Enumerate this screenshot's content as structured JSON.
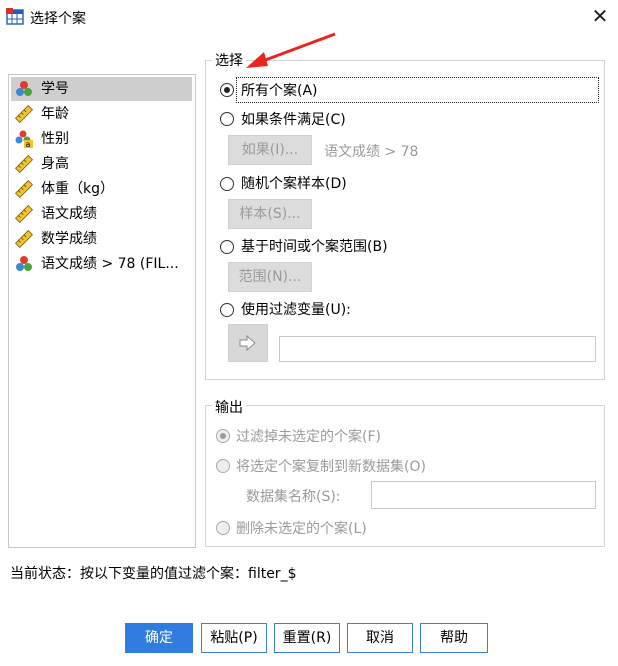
{
  "window": {
    "title": "选择个案",
    "close_symbol": "✕"
  },
  "variables": [
    {
      "label": "学号",
      "icon": "nominal-icon",
      "selected": true
    },
    {
      "label": "年龄",
      "icon": "scale-ruler-icon"
    },
    {
      "label": "性别",
      "icon": "nominal-string-icon"
    },
    {
      "label": "身高",
      "icon": "scale-ruler-icon"
    },
    {
      "label": "体重（kg）",
      "icon": "scale-ruler-icon"
    },
    {
      "label": "语文成绩",
      "icon": "scale-ruler-icon"
    },
    {
      "label": "数学成绩",
      "icon": "scale-ruler-icon"
    },
    {
      "label": "语文成绩 > 78 (FIL...",
      "icon": "nominal-icon"
    }
  ],
  "select_group": {
    "legend": "选择",
    "all_cases": "所有个案(A)",
    "if_condition": "如果条件满足(C)",
    "if_button": "如果(I)...",
    "condition_text": "语文成绩 > 78",
    "random_sample": "随机个案样本(D)",
    "sample_button": "样本(S)...",
    "time_range": "基于时间或个案范围(B)",
    "range_button": "范围(N)...",
    "filter_variable": "使用过滤变量(U):",
    "filter_value": ""
  },
  "output_group": {
    "legend": "输出",
    "filter_out": "过滤掉未选定的个案(F)",
    "copy_new": "将选定个案复制到新数据集(O)",
    "dataset_name_label": "数据集名称(S):",
    "dataset_name_value": "",
    "delete_unselected": "删除未选定的个案(L)"
  },
  "status_text": "当前状态：按以下变量的值过滤个案：filter_$",
  "buttons": {
    "ok": "确定",
    "paste": "粘贴(P)",
    "reset": "重置(R)",
    "cancel": "取消",
    "help": "帮助"
  },
  "colors": {
    "primary": "#2f7de1",
    "annotation_arrow": "#e8251f",
    "selected_row": "#cfcfcf"
  }
}
